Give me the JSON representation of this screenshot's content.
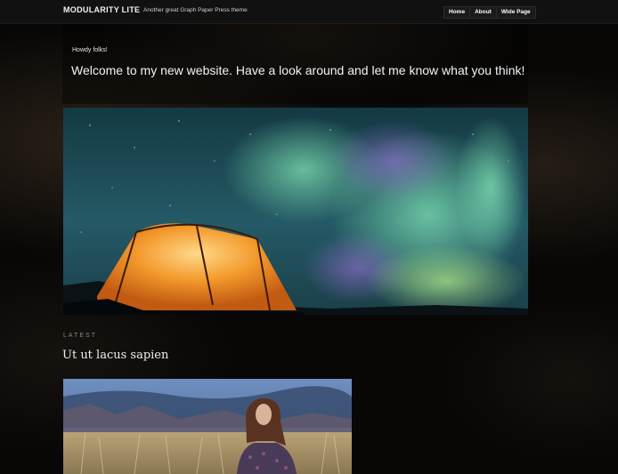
{
  "header": {
    "site_title": "MODULARITY LITE",
    "tagline": "Another great Graph Paper Press theme",
    "nav": [
      "Home",
      "About",
      "Wide Page"
    ]
  },
  "intro": {
    "greeting": "Howdy folks!",
    "welcome": "Welcome to my new website. Have a look around and let me know what you think!"
  },
  "hero": {
    "icon": "aurora-tent-photo"
  },
  "latest": {
    "label": "LATEST",
    "post_title": "Ut ut lacus sapien",
    "thumbnail_icon": "woman-in-field-photo"
  },
  "colors": {
    "background": "#080706",
    "topbar": "#111111",
    "text": "#f2f2f2",
    "muted": "#8a8a8a"
  }
}
